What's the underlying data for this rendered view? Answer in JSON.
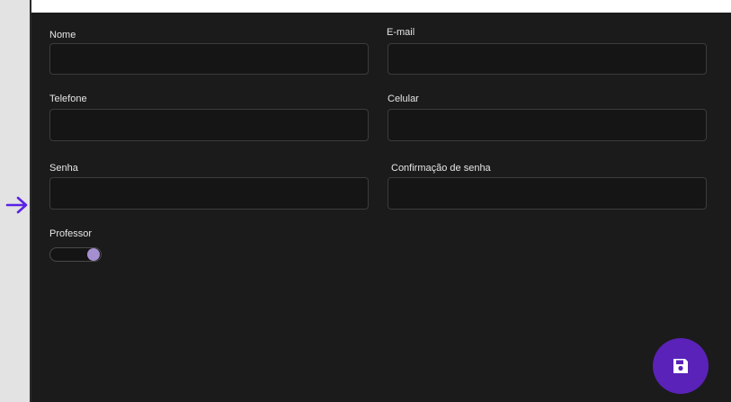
{
  "form": {
    "nome_label": "Nome",
    "nome_value": "",
    "email_label": "E-mail",
    "email_value": "",
    "telefone_label": "Telefone",
    "telefone_value": "",
    "celular_label": "Celular",
    "celular_value": "",
    "senha_label": "Senha",
    "senha_value": "",
    "confirmacao_label": "Confirmação de senha",
    "confirmacao_value": "",
    "professor_label": "Professor",
    "professor_checked": true
  },
  "icons": {
    "expand": "arrow-right-icon",
    "save": "floppy-disk-icon"
  },
  "colors": {
    "background": "#1b1b1b",
    "accent": "#5a22b8",
    "arrow": "#5a22e6",
    "toggle_thumb": "#a58fd0"
  }
}
